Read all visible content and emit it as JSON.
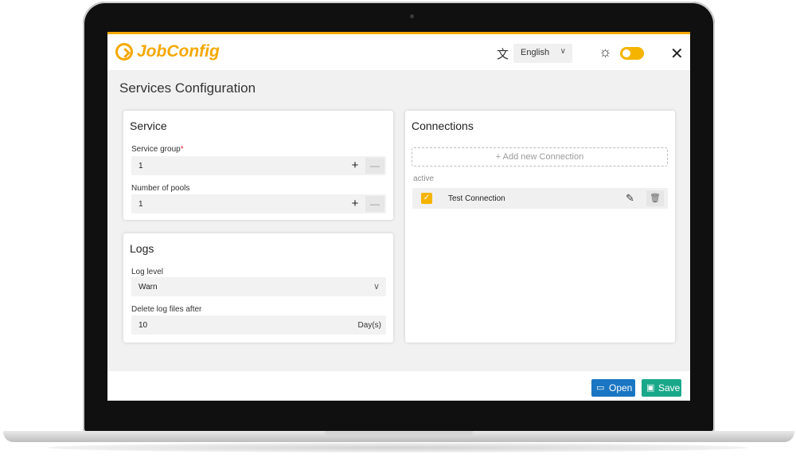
{
  "header": {
    "logo_text": "JobConfig",
    "language": "English",
    "theme_toggle_on": true
  },
  "page": {
    "title": "Services Configuration"
  },
  "service": {
    "title": "Service",
    "service_group_label": "Service group",
    "required_mark": "*",
    "service_group_value": "1",
    "pools_label": "Number of pools",
    "pools_value": "1",
    "plus": "+",
    "minus": "—"
  },
  "logs": {
    "title": "Logs",
    "level_label": "Log level",
    "level_value": "Warn",
    "delete_label": "Delete log files after",
    "delete_value": "10",
    "delete_unit": "Day(s)"
  },
  "connections": {
    "title": "Connections",
    "add_label": "+ Add new Connection",
    "active_label": "active",
    "items": [
      {
        "name": "Test Connection",
        "checked": true
      }
    ]
  },
  "footer": {
    "open_label": "Open",
    "save_label": "Save"
  },
  "colors": {
    "brand": "#f5a800",
    "open_button": "#1a76c2",
    "save_button": "#1aa88a",
    "required": "#d9262c"
  }
}
